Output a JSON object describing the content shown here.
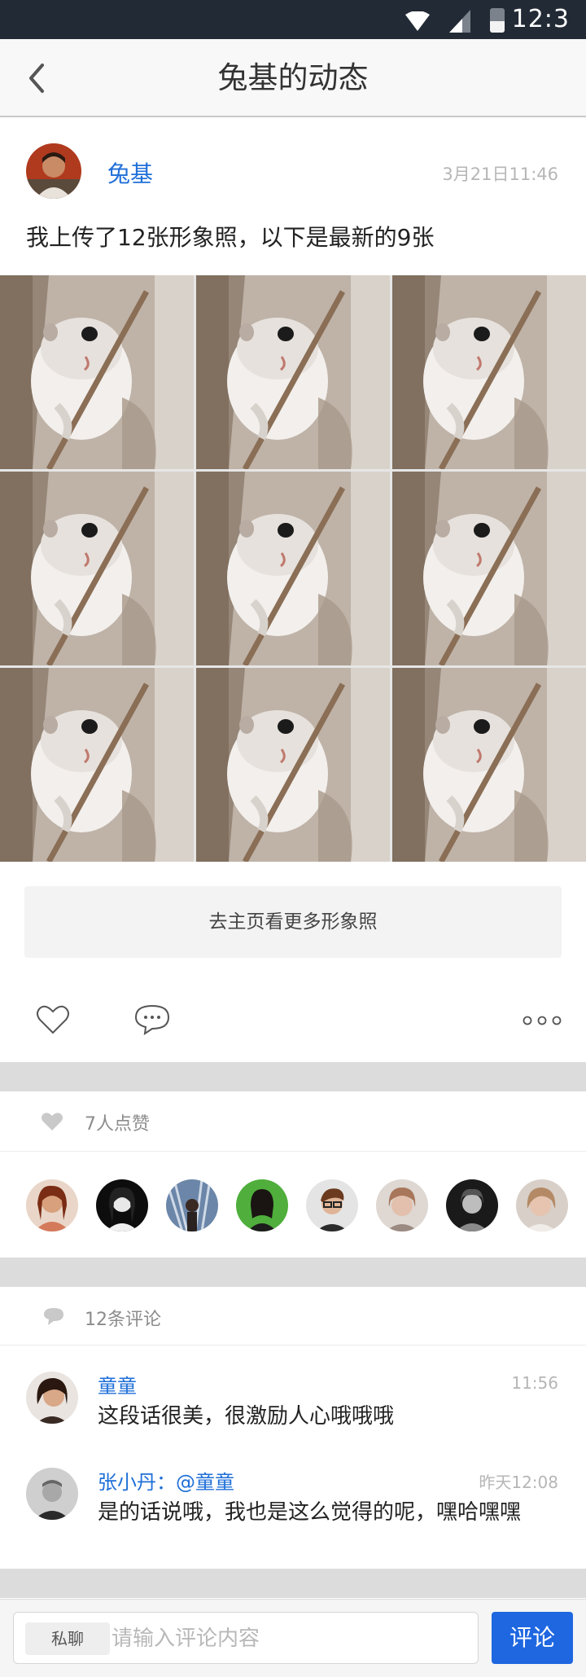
{
  "status_bar": {
    "time": "12:3"
  },
  "nav": {
    "title": "兔基的动态"
  },
  "post": {
    "author": "兔基",
    "time": "3月21日11:46",
    "text": "我上传了12张形象照，以下是最新的9张",
    "photo_count": 9,
    "more_label": "去主页看更多形象照"
  },
  "likes": {
    "summary": "7人点赞",
    "avatar_count": 8
  },
  "comments": {
    "summary": "12条评论",
    "items": [
      {
        "name": "童童",
        "at": "",
        "time": "11:56",
        "body": "这段话很美，很激励人心哦哦哦"
      },
      {
        "name": "张小丹：",
        "at": "@童童",
        "time": "昨天12:08",
        "body": "是的话说哦，我也是这么觉得的呢，嘿哈嘿嘿"
      }
    ]
  },
  "bottom": {
    "dm_label": "私聊",
    "input_placeholder": "请输入评论内容",
    "send_label": "评论"
  },
  "colors": {
    "accent": "#1e67e0",
    "name_link": "#1f6fd8",
    "status_bar": "#222a35",
    "separator": "#dcdcdc"
  }
}
